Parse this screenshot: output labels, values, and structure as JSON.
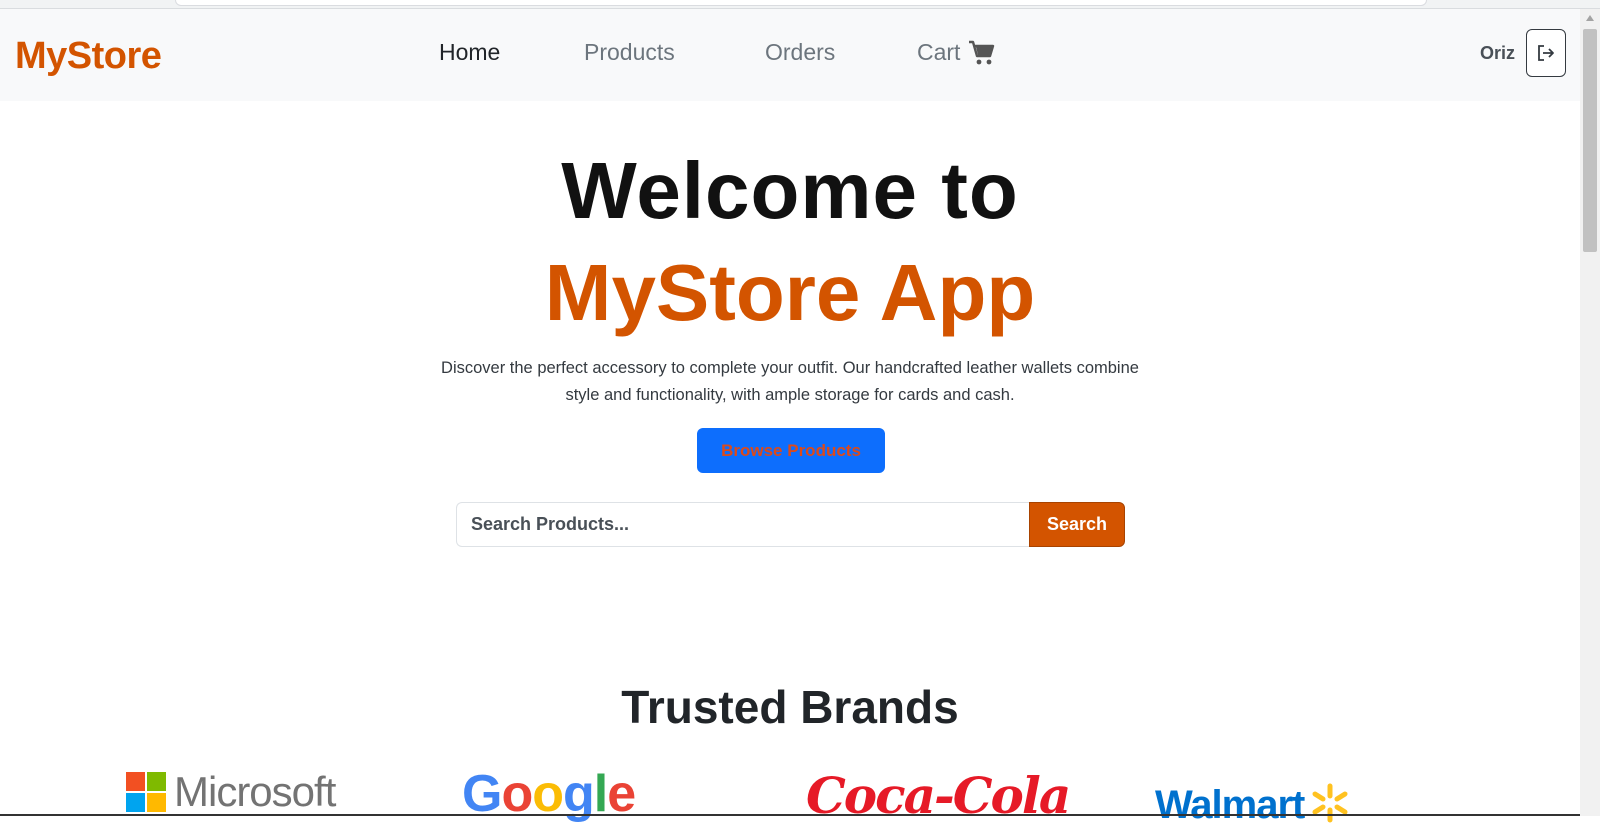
{
  "navbar": {
    "brand": "MyStore",
    "links": [
      {
        "label": "Home",
        "active": true
      },
      {
        "label": "Products",
        "active": false
      },
      {
        "label": "Orders",
        "active": false
      },
      {
        "label": "Cart",
        "active": false
      }
    ],
    "user_name": "Oriz",
    "icons": {
      "cart": "cart-icon",
      "logout": "logout-icon"
    }
  },
  "hero": {
    "line1": "Welcome to",
    "line2": "MyStore App",
    "description": "Discover the perfect accessory to complete your outfit. Our handcrafted leather wallets combine style and functionality, with ample storage for cards and cash.",
    "browse_label": "Browse Products"
  },
  "search": {
    "placeholder": "Search Products...",
    "button_label": "Search"
  },
  "brands": {
    "title": "Trusted Brands",
    "logos": [
      "Microsoft",
      "Google",
      "Coca-Cola",
      "Walmart"
    ]
  },
  "colors": {
    "accent": "#d35400",
    "primary_button": "#0d6efd",
    "nav_bg": "#f8f9fa"
  }
}
